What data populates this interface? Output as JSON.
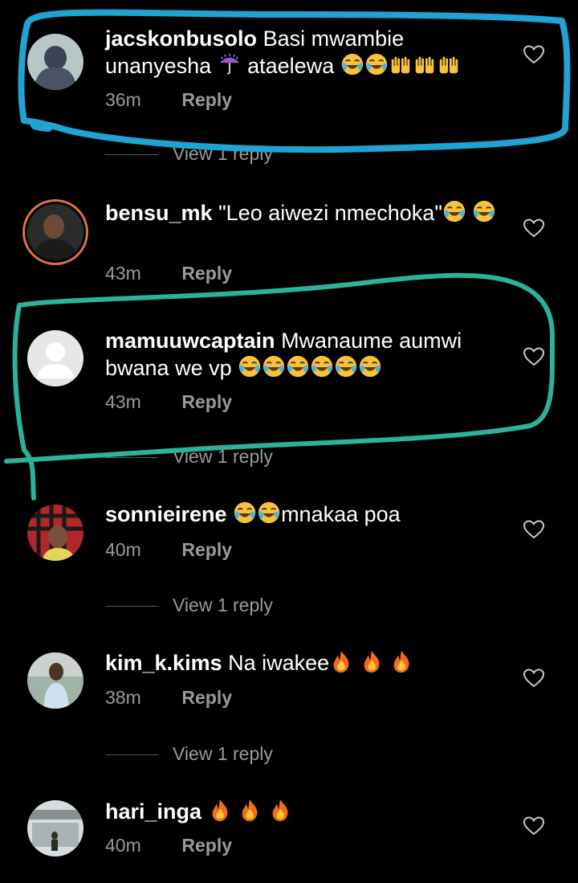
{
  "comments": [
    {
      "username": "jacskonbusolo",
      "text": "Basi mwambie unanyesha ☔ ataelewa 😂😂🙌🙌🙌",
      "time": "36m",
      "reply": "Reply",
      "view_replies": "View 1 reply"
    },
    {
      "username": "bensu_mk",
      "text": "\"Leo aiwezi nmechoka\"😂😂",
      "time": "43m",
      "reply": "Reply"
    },
    {
      "username": "mamuuwcaptain",
      "text": "Mwanaume aumwi bwana we vp 😂😂😂😂😂😂",
      "time": "43m",
      "reply": "Reply",
      "view_replies": "View 1 reply"
    },
    {
      "username": "sonnieirene",
      "text": "😂😂mnakaa poa",
      "time": "40m",
      "reply": "Reply",
      "view_replies": "View 1 reply"
    },
    {
      "username": "kim_k.kims",
      "text": "Na iwakee🔥🔥🔥",
      "time": "38m",
      "reply": "Reply",
      "view_replies": "View 1 reply"
    },
    {
      "username": "hari_inga",
      "text": "🔥🔥🔥",
      "time": "40m",
      "reply": "Reply"
    }
  ],
  "icons": {
    "like": "heart-outline-icon",
    "laugh": "face-with-tears-of-joy-icon",
    "fire": "fire-icon",
    "umbrella": "umbrella-icon",
    "raised_hands": "raised-hands-icon"
  },
  "colors": {
    "background": "#000000",
    "text": "#ffffff",
    "secondary_text": "#9a9a9a",
    "annotation_blue": "#1fa3d2",
    "annotation_teal": "#2bb39a",
    "story_ring": "#d9743f"
  }
}
